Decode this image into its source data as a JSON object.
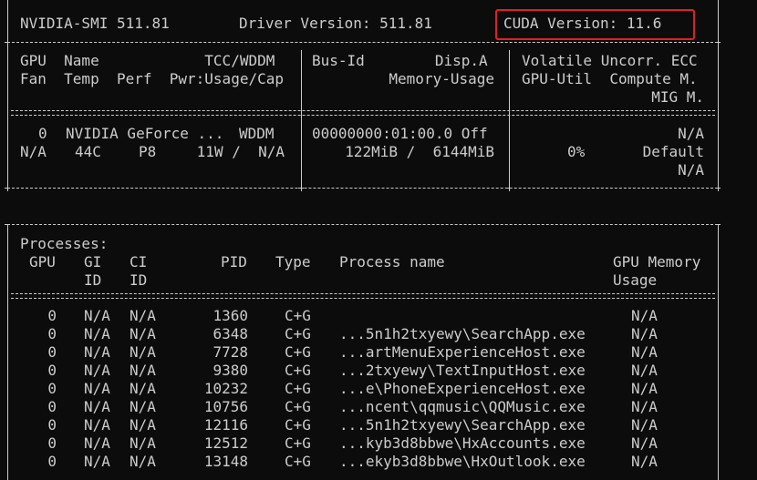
{
  "header": {
    "smi": "NVIDIA-SMI 511.81",
    "driver": "Driver Version: 511.81",
    "cuda": "CUDA Version: 11.6"
  },
  "gpu_table": {
    "col1_h1": "GPU  Name            TCC/WDDM",
    "col1_h2": "Fan  Temp  Perf  Pwr:Usage/Cap",
    "col2_h1": "Bus-Id        Disp.A",
    "col2_h2": "Memory-Usage",
    "col3_h1": "Volatile Uncorr. ECC",
    "col3_h2": "GPU-Util  Compute M.",
    "col3_h3": "MIG M.",
    "row": {
      "gpu": "0",
      "name": "NVIDIA GeForce ...",
      "mode": "WDDM",
      "bus": "00000000:01:00.0 Off",
      "fan": "N/A",
      "temp": "44C",
      "perf": "P8",
      "power": "11W /  N/A",
      "memory": "122MiB /  6144MiB",
      "ecc": "N/A",
      "util": "0%",
      "compute": "Default",
      "mig": "N/A"
    }
  },
  "processes": {
    "title": "Processes:",
    "headers": {
      "gpu": "GPU",
      "gi": "GI",
      "gi2": "ID",
      "ci": "CI",
      "ci2": "ID",
      "pid": "PID",
      "type": "Type",
      "name": "Process name",
      "mem": "GPU Memory",
      "mem2": "Usage"
    },
    "rows": [
      {
        "gpu": "0",
        "gi": "N/A",
        "ci": "N/A",
        "pid": "1360",
        "type": "C+G",
        "name": "",
        "mem": "N/A"
      },
      {
        "gpu": "0",
        "gi": "N/A",
        "ci": "N/A",
        "pid": "6348",
        "type": "C+G",
        "name": "...5n1h2txyewy\\SearchApp.exe",
        "mem": "N/A"
      },
      {
        "gpu": "0",
        "gi": "N/A",
        "ci": "N/A",
        "pid": "7728",
        "type": "C+G",
        "name": "...artMenuExperienceHost.exe",
        "mem": "N/A"
      },
      {
        "gpu": "0",
        "gi": "N/A",
        "ci": "N/A",
        "pid": "9380",
        "type": "C+G",
        "name": "...2txyewy\\TextInputHost.exe",
        "mem": "N/A"
      },
      {
        "gpu": "0",
        "gi": "N/A",
        "ci": "N/A",
        "pid": "10232",
        "type": "C+G",
        "name": "...e\\PhoneExperienceHost.exe",
        "mem": "N/A"
      },
      {
        "gpu": "0",
        "gi": "N/A",
        "ci": "N/A",
        "pid": "10756",
        "type": "C+G",
        "name": "...ncent\\qqmusic\\QQMusic.exe",
        "mem": "N/A"
      },
      {
        "gpu": "0",
        "gi": "N/A",
        "ci": "N/A",
        "pid": "12116",
        "type": "C+G",
        "name": "...5n1h2txyewy\\SearchApp.exe",
        "mem": "N/A"
      },
      {
        "gpu": "0",
        "gi": "N/A",
        "ci": "N/A",
        "pid": "12512",
        "type": "C+G",
        "name": "...kyb3d8bbwe\\HxAccounts.exe",
        "mem": "N/A"
      },
      {
        "gpu": "0",
        "gi": "N/A",
        "ci": "N/A",
        "pid": "13148",
        "type": "C+G",
        "name": "...ekyb3d8bbwe\\HxOutlook.exe",
        "mem": "N/A"
      }
    ]
  },
  "colors": {
    "background": "#0c0c0c",
    "text": "#cccccc",
    "highlight_box": "#e02020"
  }
}
